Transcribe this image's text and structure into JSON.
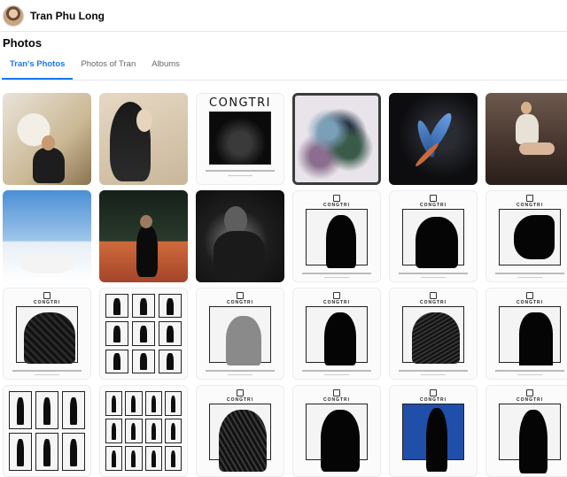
{
  "profile": {
    "name": "Tran Phu Long"
  },
  "section": {
    "title": "Photos"
  },
  "tabs": [
    {
      "label": "Tran's Photos",
      "active": true
    },
    {
      "label": "Photos of Tran",
      "active": false
    },
    {
      "label": "Albums",
      "active": false
    }
  ],
  "tiles": {
    "congtri_banner": "CONGTRI",
    "logo_small": "CONGTRI"
  },
  "colors": {
    "accent": "#1877f2",
    "muted": "#65676b",
    "divider": "#e4e6eb"
  }
}
